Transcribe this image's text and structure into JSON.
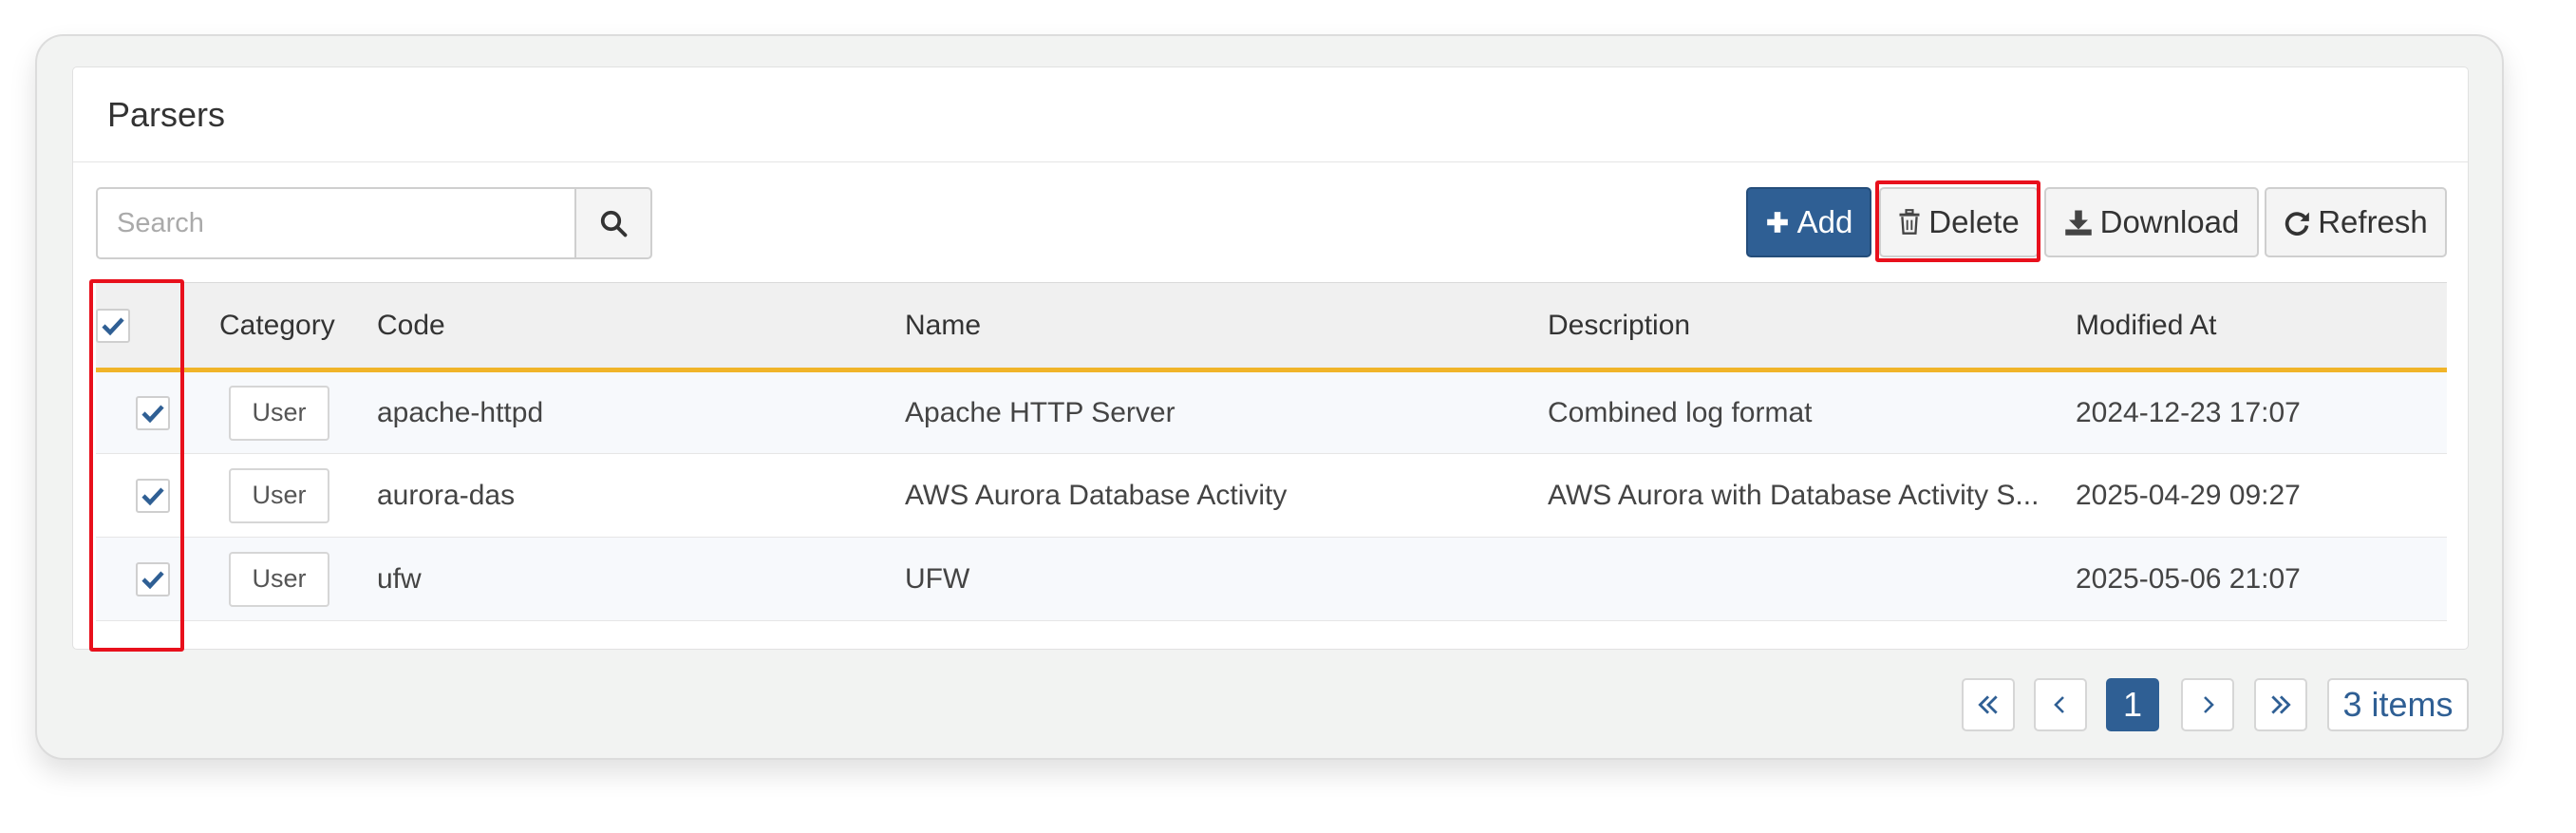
{
  "panel": {
    "title": "Parsers"
  },
  "search": {
    "placeholder": "Search",
    "value": ""
  },
  "toolbar": {
    "add_label": "Add",
    "delete_label": "Delete",
    "download_label": "Download",
    "refresh_label": "Refresh"
  },
  "table": {
    "columns": [
      "Category",
      "Code",
      "Name",
      "Description",
      "Modified At"
    ],
    "select_all_checked": true,
    "rows": [
      {
        "checked": true,
        "category": "User",
        "code": "apache-httpd",
        "name": "Apache HTTP Server",
        "description": "Combined log format",
        "modified_at": "2024-12-23 17:07"
      },
      {
        "checked": true,
        "category": "User",
        "code": "aurora-das",
        "name": "AWS Aurora Database Activity",
        "description": "AWS Aurora with Database Activity S...",
        "modified_at": "2025-04-29 09:27"
      },
      {
        "checked": true,
        "category": "User",
        "code": "ufw",
        "name": "UFW",
        "description": "",
        "modified_at": "2025-05-06 21:07"
      }
    ]
  },
  "pager": {
    "current_page": "1",
    "total_label": "3 items"
  },
  "colors": {
    "primary": "#2f5f94",
    "highlight": "#e8101c",
    "header_underline": "#f0b429"
  },
  "icons": [
    "search-icon",
    "plus-icon",
    "trash-icon",
    "download-icon",
    "refresh-icon",
    "check-icon",
    "first-page-icon",
    "prev-page-icon",
    "next-page-icon",
    "last-page-icon"
  ]
}
